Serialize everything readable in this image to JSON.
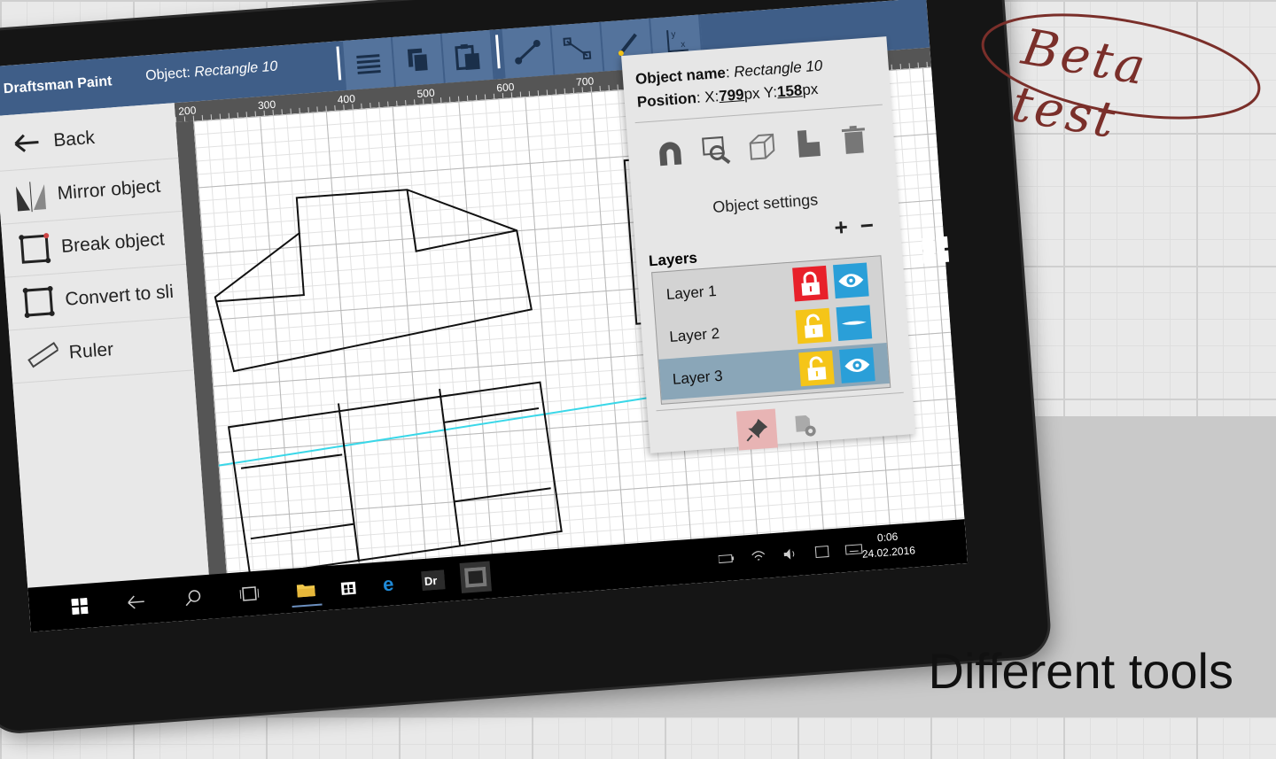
{
  "app": {
    "title": "Draftsman Paint",
    "object_prefix": "Object: ",
    "object_value": "Rectangle 10"
  },
  "toolbar": {
    "buttons": [
      "text-lines-icon",
      "copy-icon",
      "paste-icon",
      "line-tool-icon",
      "diagonal-tool-icon",
      "pen-tool-icon",
      "axis-icon"
    ]
  },
  "ruler": {
    "marks": [
      "200",
      "300",
      "400",
      "500",
      "600",
      "700"
    ]
  },
  "sidebar": {
    "items": [
      {
        "label": "Back",
        "icon": "back-arrow-icon"
      },
      {
        "label": "Mirror object",
        "icon": "mirror-icon"
      },
      {
        "label": "Break object",
        "icon": "break-icon"
      },
      {
        "label": "Convert to sli",
        "icon": "convert-icon"
      },
      {
        "label": "Ruler",
        "icon": "ruler-icon"
      }
    ]
  },
  "object_panel": {
    "name_label": "Object name",
    "name_value": "Rectangle 10",
    "position_label": "Position",
    "x_label": "X:",
    "x_value": "799",
    "y_label": "Y:",
    "y_value": "158",
    "unit": "px",
    "tools": [
      "magnet-icon",
      "zoom-fit-icon",
      "cube-icon",
      "step-shape-icon",
      "trash-icon"
    ],
    "settings_label": "Object settings",
    "add_label": "+",
    "remove_label": "−",
    "layers_title": "Layers",
    "layers": [
      {
        "name": "Layer 1",
        "locked": true,
        "visible": true,
        "selected": false
      },
      {
        "name": "Layer 2",
        "locked": false,
        "visible": false,
        "selected": false
      },
      {
        "name": "Layer 3",
        "locked": false,
        "visible": true,
        "selected": true
      }
    ],
    "colors": {
      "locked": "#e8202a",
      "unlocked": "#f5c518",
      "eye": "#2a9fd8",
      "selected": "#8aa6b8",
      "pin_bg": "#e8b4b4"
    }
  },
  "taskbar": {
    "time": "0:06",
    "date": "24.02.2016"
  },
  "marketing": {
    "stamp": "Beta test",
    "tagline": "Different tools"
  }
}
